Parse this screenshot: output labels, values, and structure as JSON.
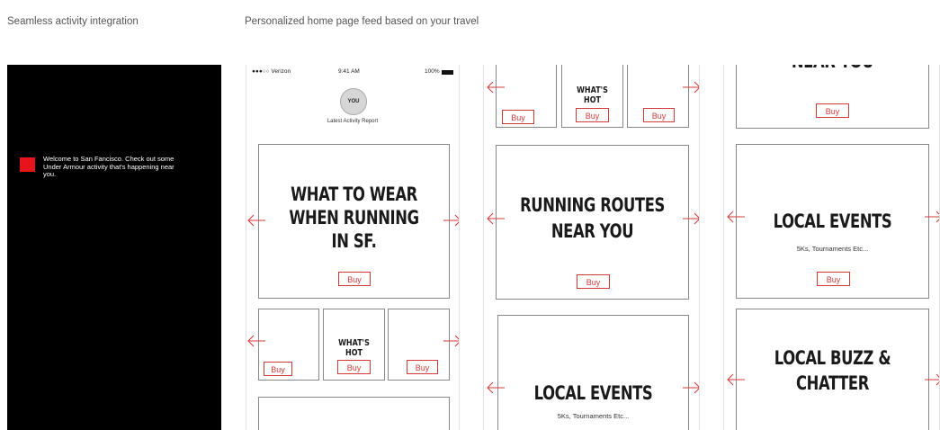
{
  "captions": {
    "left": "Seamless activity integration",
    "right": "Personalized home page feed based on your travel"
  },
  "notification": {
    "text": "Welcome to San Fancisco. Check out some Under Armour activity that's happening near you."
  },
  "status_bar": {
    "carrier": "●●●○○ Verizon ",
    "time": "9:41 AM",
    "battery": "100%"
  },
  "profile": {
    "avatar_label": "YOU",
    "report_label": "Latest Activity Report"
  },
  "cards": {
    "what_to_wear": [
      "WHAT TO WEAR",
      "WHEN RUNNING",
      "IN SF."
    ],
    "whats_hot": "WHAT'S HOT",
    "running_routes": [
      "RUNNING ROUTES",
      "NEAR YOU"
    ],
    "near_you_partial": "NEAR YOU",
    "local_events": "LOCAL EVENTS",
    "local_events_sub": "5Ks, Tournaments Etc...",
    "local_buzz": [
      "LOCAL BUZZ &",
      "CHATTER"
    ]
  },
  "buy_label": "Buy",
  "colors": {
    "accent": "#e8141c",
    "buy": "#d23a3a",
    "black_panel": "#000000"
  },
  "icons": [
    "arrow-left-icon",
    "arrow-right-icon",
    "wifi-icon",
    "battery-icon"
  ]
}
